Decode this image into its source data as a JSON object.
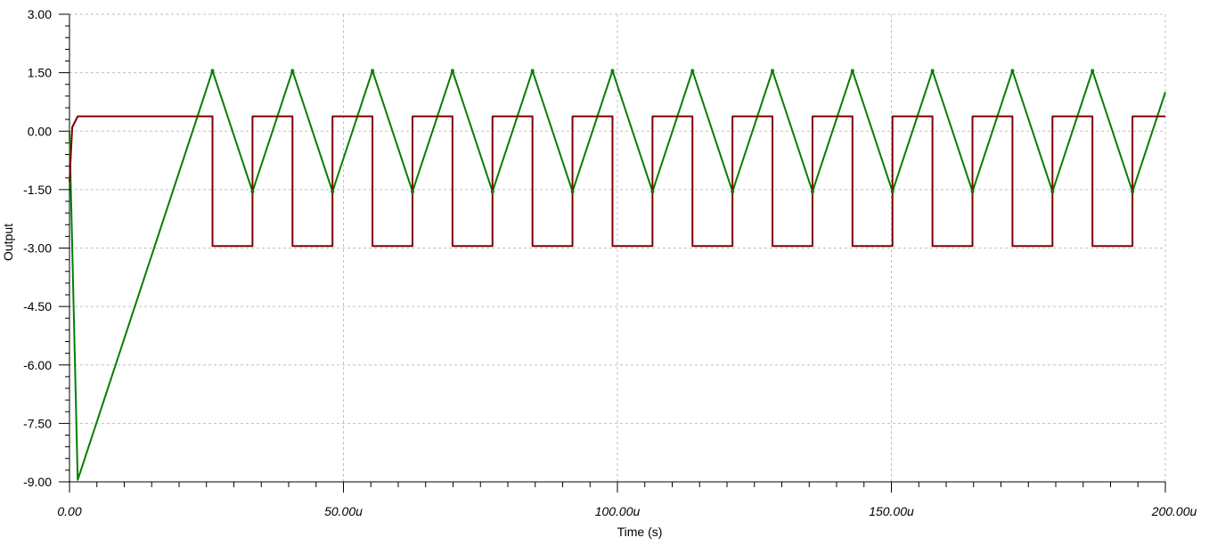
{
  "chart_data": {
    "type": "line",
    "xlabel": "Time (s)",
    "ylabel": "Output",
    "xlim": [
      0,
      200
    ],
    "ylim": [
      -9,
      3
    ],
    "x_unit": "u",
    "grid": true,
    "legend": "none",
    "xticks": [
      {
        "value": 0,
        "label": "0.00"
      },
      {
        "value": 50,
        "label": "50.00u"
      },
      {
        "value": 100,
        "label": "100.00u"
      },
      {
        "value": 150,
        "label": "150.00u"
      },
      {
        "value": 200,
        "label": "200.00u"
      }
    ],
    "yticks": [
      {
        "value": 3,
        "label": "3.00"
      },
      {
        "value": 1.5,
        "label": "1.50"
      },
      {
        "value": 0,
        "label": "0.00"
      },
      {
        "value": -1.5,
        "label": "-1.50"
      },
      {
        "value": -3,
        "label": "-3.00"
      },
      {
        "value": -4.5,
        "label": "-4.50"
      },
      {
        "value": -6,
        "label": "-6.00"
      },
      {
        "value": -7.5,
        "label": "-7.50"
      },
      {
        "value": -9,
        "label": "-9.00"
      }
    ],
    "series": [
      {
        "color": "#008000",
        "x": [
          0,
          1.5,
          26.1,
          33.4,
          40.7,
          48.0,
          55.3,
          62.6,
          69.9,
          77.2,
          84.5,
          91.8,
          99.1,
          106.4,
          113.7,
          121.0,
          128.3,
          135.6,
          142.9,
          150.2,
          157.5,
          164.8,
          172.1,
          179.4,
          186.7,
          194.0,
          200
        ],
        "y": [
          0,
          -8.95,
          1.55,
          -1.55,
          1.55,
          -1.55,
          1.55,
          -1.55,
          1.55,
          -1.55,
          1.55,
          -1.55,
          1.55,
          -1.55,
          1.55,
          -1.55,
          1.55,
          -1.55,
          1.55,
          -1.55,
          1.55,
          -1.55,
          1.55,
          -1.55,
          1.55,
          -1.55,
          1.0
        ]
      },
      {
        "color": "#800000",
        "x": [
          0,
          0.5,
          1.5,
          26.1,
          26.1,
          33.4,
          33.4,
          40.7,
          40.7,
          48.0,
          48.0,
          55.3,
          55.3,
          62.6,
          62.6,
          69.9,
          69.9,
          77.2,
          77.2,
          84.5,
          84.5,
          91.8,
          91.8,
          99.1,
          99.1,
          106.4,
          106.4,
          113.7,
          113.7,
          121.0,
          121.0,
          128.3,
          128.3,
          135.6,
          135.6,
          142.9,
          142.9,
          150.2,
          150.2,
          157.5,
          157.5,
          164.8,
          164.8,
          172.1,
          172.1,
          179.4,
          179.4,
          186.7,
          186.7,
          194.0,
          194.0,
          200
        ],
        "y": [
          -1.3,
          0.1,
          0.38,
          0.38,
          -2.95,
          -2.95,
          0.38,
          0.38,
          -2.95,
          -2.95,
          0.38,
          0.38,
          -2.95,
          -2.95,
          0.38,
          0.38,
          -2.95,
          -2.95,
          0.38,
          0.38,
          -2.95,
          -2.95,
          0.38,
          0.38,
          -2.95,
          -2.95,
          0.38,
          0.38,
          -2.95,
          -2.95,
          0.38,
          0.38,
          -2.95,
          -2.95,
          0.38,
          0.38,
          -2.95,
          -2.95,
          0.38,
          0.38,
          -2.95,
          -2.95,
          0.38,
          0.38,
          -2.95,
          -2.95,
          0.38,
          0.38,
          -2.95,
          -2.95,
          0.38,
          0.38
        ]
      }
    ]
  }
}
